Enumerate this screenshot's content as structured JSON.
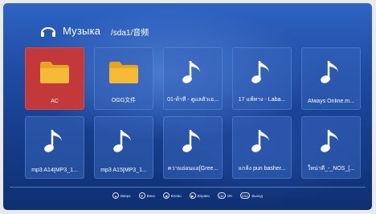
{
  "header": {
    "title": "Музыка",
    "path": "/sda1/音频",
    "icon": "headphones-icon"
  },
  "tiles": [
    {
      "label": "AC",
      "type": "folder",
      "selected": true
    },
    {
      "label": "OGG文件",
      "type": "folder",
      "selected": false
    },
    {
      "label": "01-ท้าที - ดูแลตัวเอ...",
      "type": "music",
      "selected": false
    },
    {
      "label": "17 แพ้ทาง - Laba...",
      "type": "music",
      "selected": false
    },
    {
      "label": "Always Online.m...",
      "type": "music",
      "selected": false
    },
    {
      "label": "mp3 A14[MP3_1...",
      "type": "music",
      "selected": false
    },
    {
      "label": "mp3 A15[MP3_1...",
      "type": "music",
      "selected": false
    },
    {
      "label": "ความอ่อนแอ[Gree...",
      "type": "music",
      "selected": false
    },
    {
      "label": "แกล้ง pun basher...",
      "type": "music",
      "selected": false
    },
    {
      "label": "ใหน่าดี_-_NOS_[...",
      "type": "music",
      "selected": false
    }
  ],
  "hints": [
    {
      "key": "▲",
      "label": "Вверх"
    },
    {
      "key": "▼",
      "label": "Вниз"
    },
    {
      "key": "◀",
      "label": "Влево"
    },
    {
      "key": "▶",
      "label": "Вправо"
    },
    {
      "key": "OK",
      "label": "OK"
    },
    {
      "key": "ESC",
      "label": "Выход"
    }
  ],
  "colors": {
    "selected": "#c3383a",
    "folder": "#f5b82e",
    "background": "#1f4ea6"
  }
}
